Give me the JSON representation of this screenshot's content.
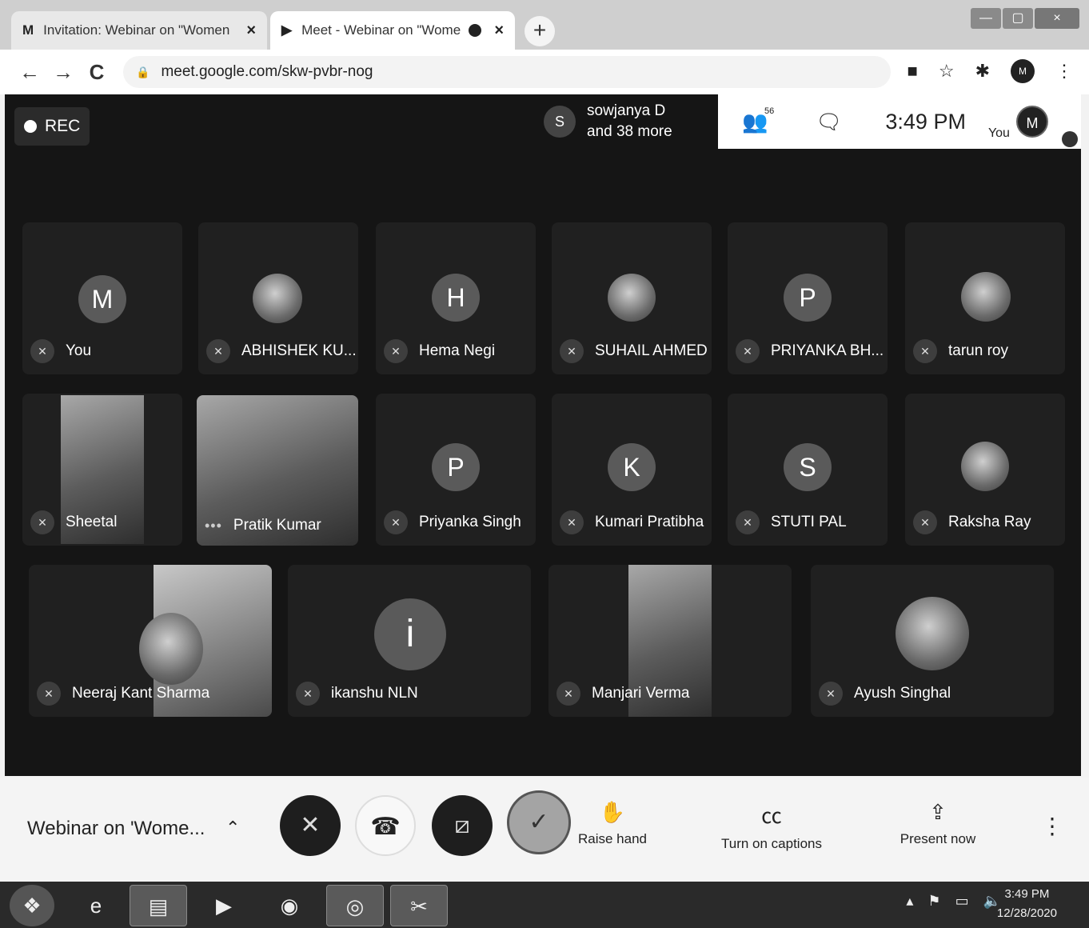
{
  "browser": {
    "tabs": [
      {
        "favicon": "M",
        "title": "Invitation: Webinar on \"Women",
        "close": "×"
      },
      {
        "favicon": "▶",
        "title": "Meet - Webinar on \"Women",
        "close": "×"
      }
    ],
    "new_tab": "+",
    "window_controls": {
      "minimize": "—",
      "maximize": "▢",
      "close": "×"
    },
    "nav": {
      "back": "←",
      "forward": "→",
      "reload": "C"
    },
    "url": "meet.google.com/skw-pvbr-nog",
    "icons": [
      "camera-icon",
      "star-icon",
      "extensions-icon",
      "profile-avatar",
      "menu-icon"
    ],
    "profile_initial": "M"
  },
  "meet": {
    "rec_label": "REC",
    "presenter": {
      "initial": "S",
      "line1": "sowjanya D",
      "line2": "and 38 more"
    },
    "top": {
      "participant_count": "56",
      "time": "3:49 PM",
      "you_label": "You",
      "avatar_initial": "M"
    },
    "participants": [
      {
        "name": "You",
        "avatar": "M"
      },
      {
        "name": "ABHISHEK KU...",
        "avatar": ""
      },
      {
        "name": "Hema Negi",
        "avatar": "H"
      },
      {
        "name": "SUHAIL AHMED",
        "avatar": ""
      },
      {
        "name": "PRIYANKA BH...",
        "avatar": "P"
      },
      {
        "name": "tarun roy",
        "avatar": ""
      },
      {
        "name": "Sheetal",
        "avatar": ""
      },
      {
        "name": "Pratik Kumar",
        "avatar": ""
      },
      {
        "name": "Priyanka Singh",
        "avatar": "P"
      },
      {
        "name": "Kumari Pratibha",
        "avatar": "K"
      },
      {
        "name": "STUTI PAL",
        "avatar": "S"
      },
      {
        "name": "Raksha Ray",
        "avatar": ""
      },
      {
        "name": "Neeraj Kant Sharma",
        "avatar": ""
      },
      {
        "name": "ikanshu NLN",
        "avatar": "i"
      },
      {
        "name": "Manjari Verma",
        "avatar": ""
      },
      {
        "name": "Ayush Singhal",
        "avatar": ""
      }
    ],
    "bottom": {
      "meeting_title": "Webinar on 'Wome...",
      "raise_hand": "Raise hand",
      "captions": "Turn on captions",
      "present": "Present now"
    }
  },
  "taskbar": {
    "time": "3:49 PM",
    "date": "12/28/2020"
  }
}
